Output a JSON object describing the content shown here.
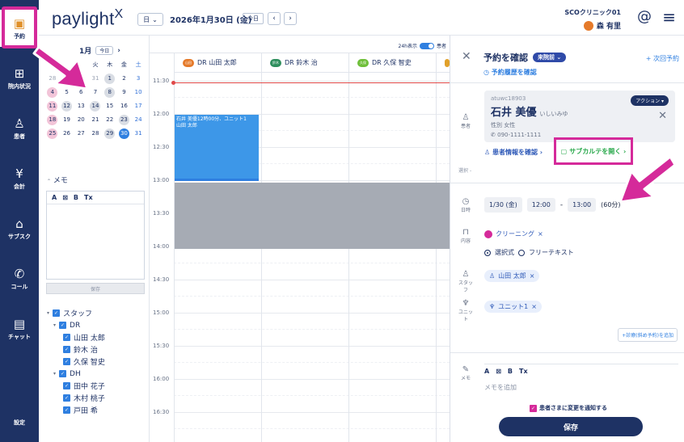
{
  "rail": {
    "items": [
      {
        "label": "予約",
        "icon": "calendar-plus-icon"
      },
      {
        "label": "院内状況",
        "icon": "building-icon"
      },
      {
        "label": "患者",
        "icon": "user-plus-icon"
      },
      {
        "label": "会計",
        "icon": "yen-icon"
      },
      {
        "label": "サブスク",
        "icon": "subscription-icon"
      },
      {
        "label": "コール",
        "icon": "phone-icon"
      },
      {
        "label": "チャット",
        "icon": "chat-icon"
      }
    ],
    "settings_label": "設定"
  },
  "topbar": {
    "logo": "paylight",
    "logo_x": "X",
    "view": "日",
    "date": "2026年1月30日 (金)",
    "today": "今日",
    "prev": "‹",
    "next": "›",
    "clinic": "SCOクリニック01",
    "user": "森 有里"
  },
  "minical": {
    "month": "1月",
    "today": "今日",
    "next": "›",
    "weekdays": [
      "",
      "",
      "",
      "火",
      "木",
      "金",
      "土"
    ],
    "rows": [
      [
        "28",
        "29",
        "30",
        "31",
        "1",
        "2",
        "3"
      ],
      [
        "4",
        "5",
        "6",
        "7",
        "8",
        "9",
        "10"
      ],
      [
        "11",
        "12",
        "13",
        "14",
        "15",
        "16",
        "17"
      ],
      [
        "18",
        "19",
        "20",
        "21",
        "22",
        "23",
        "24"
      ],
      [
        "25",
        "26",
        "27",
        "28",
        "29",
        "30",
        "31"
      ]
    ]
  },
  "memo": {
    "title": "メモ",
    "tools": [
      "A",
      "⊠",
      "B",
      "Tx"
    ],
    "save": "保存"
  },
  "staff": {
    "title": "スタッフ",
    "groups": [
      {
        "name": "DR",
        "members": [
          "山田 太郎",
          "鈴木 治",
          "久保 智史"
        ]
      },
      {
        "name": "DH",
        "members": [
          "田中 花子",
          "木村 桃子",
          "戸田 希"
        ]
      }
    ]
  },
  "calendar": {
    "toggle_label": "24h表示",
    "toggle_label2": "患者",
    "columns": [
      {
        "label": "DR 山田 太郎",
        "badge": "山田",
        "color": "#e57a2a"
      },
      {
        "label": "DR 鈴木 治",
        "badge": "鈴木",
        "color": "#2f8f5e"
      },
      {
        "label": "DR 久保 智史",
        "badge": "久保",
        "color": "#6fbf3a"
      }
    ],
    "times": [
      "11:30",
      "12:00",
      "12:30",
      "13:00",
      "13:30",
      "14:00",
      "14:30",
      "15:00",
      "15:30",
      "16:00",
      "16:30"
    ],
    "appointment": {
      "line1": "石井 美優12時00分、ユニット1",
      "line2": "山田 太郎"
    }
  },
  "panel": {
    "title": "予約を確認",
    "status": "来院前",
    "next_reservation": "+ 次回予約",
    "history": "予約履歴を確認",
    "patient": {
      "id": "atuwc18903",
      "name": "石井 美優",
      "kana": "いしいみゆ",
      "gender": "性別 女性",
      "phone": "090-1111-1111",
      "action": "アクション"
    },
    "patient_label": "患者",
    "link_patient_info": "患者情報を確認 ›",
    "link_subkarte": "サブカルテを開く ›",
    "warning_label": "選択",
    "warning_value": "-",
    "datetime_label": "日時",
    "date": "1/30 (金)",
    "start": "12:00",
    "dash": "-",
    "end": "13:00",
    "duration": "(60分)",
    "content_label": "内容",
    "content_chip": "クリーニング",
    "radio_selected": "選択式",
    "radio_other": "フリーテキスト",
    "staff_label": "スタッフ",
    "staff_chip": "山田 太郎",
    "unit_label": "ユニット",
    "unit_chip": "ユニット1",
    "add_link": "+診療(斜め予約)を追加",
    "memo_label": "メモ",
    "memo_tools": [
      "A",
      "⊠",
      "B",
      "Tx"
    ],
    "memo_placeholder": "メモを追加",
    "notify": "患者さまに変更を通知する",
    "save": "保存"
  },
  "colors": {
    "nav": "#1e3264",
    "accent": "#2f7fe0",
    "highlight": "#d52a9a",
    "appointment": "#3d97e8",
    "blocked": "#a6abb4"
  }
}
